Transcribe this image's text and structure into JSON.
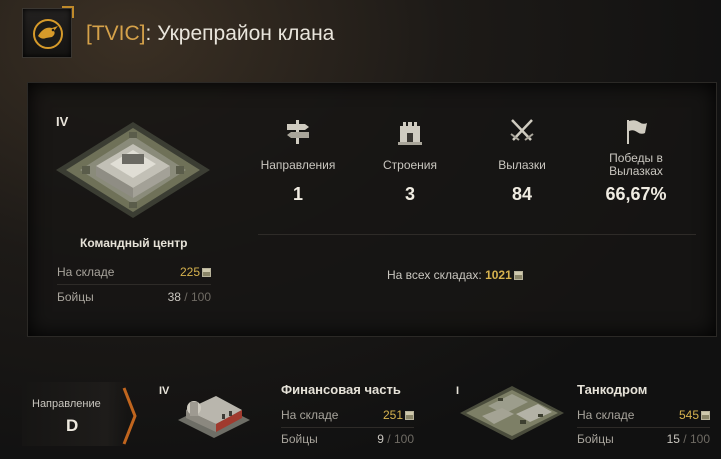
{
  "header": {
    "tag": "[TVIC]",
    "separator": ":",
    "title": "Укрепрайон клана",
    "emblem_icon": "eagle-emblem-icon"
  },
  "command_center": {
    "tier": "IV",
    "name": "Командный центр",
    "storage_label": "На складе",
    "storage_value": "225",
    "fighters_label": "Бойцы",
    "fighters_value": "38",
    "fighters_max": " / 100"
  },
  "stats": [
    {
      "label": "Направления",
      "value": "1",
      "icon": "signpost-icon"
    },
    {
      "label": "Строения",
      "value": "3",
      "icon": "tower-icon"
    },
    {
      "label": "Вылазки",
      "value": "84",
      "icon": "crossed-swords-icon"
    },
    {
      "label": "Победы в Вылазках",
      "value": "66,67%",
      "icon": "flag-icon"
    }
  ],
  "total_storage": {
    "label": "На всех складах:",
    "value": "1021"
  },
  "direction": {
    "label": "Направление",
    "value": "D"
  },
  "buildings": [
    {
      "tier": "IV",
      "name": "Финансовая часть",
      "storage_label": "На складе",
      "storage_value": "251",
      "fighters_label": "Бойцы",
      "fighters_value": "9",
      "fighters_max": " / 100"
    },
    {
      "tier": "I",
      "name": "Танкодром",
      "storage_label": "На складе",
      "storage_value": "545",
      "fighters_label": "Бойцы",
      "fighters_value": "15",
      "fighters_max": " / 100"
    }
  ],
  "colors": {
    "accent_gold": "#d6b24e",
    "tag_orange": "#d6a24a",
    "chevron_orange": "#c0651e"
  }
}
